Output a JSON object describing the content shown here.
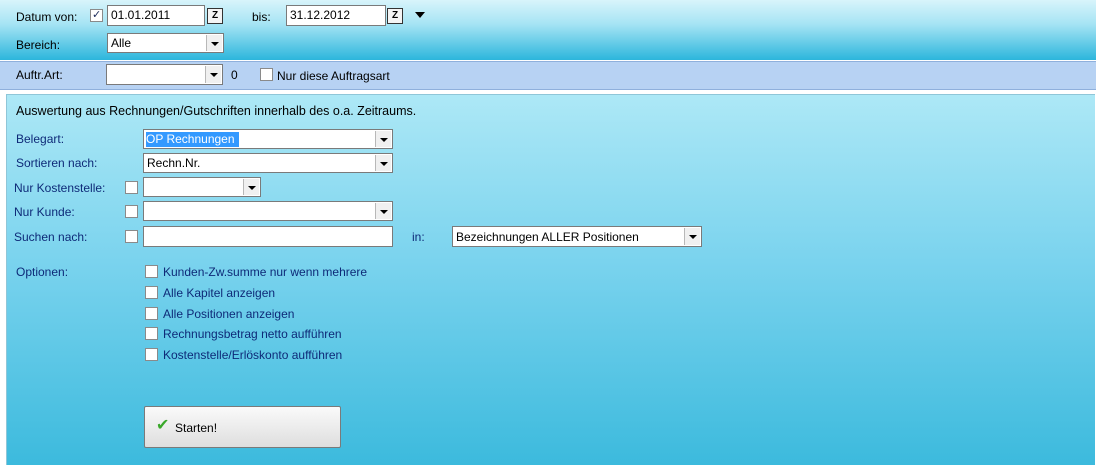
{
  "header": {
    "datum_von_label": "Datum von:",
    "datum_von_checked": true,
    "datum_von_value": "01.01.2011",
    "bis_label": "bis:",
    "bis_value": "31.12.2012",
    "calendar_glyph": "Z",
    "bereich_label": "Bereich:",
    "bereich_value": "Alle"
  },
  "auftr": {
    "label": "Auftr.Art:",
    "value": "",
    "count": "0",
    "nur_diese_label": "Nur diese Auftragsart",
    "nur_diese_checked": false
  },
  "main": {
    "description": "Auswertung aus Rechnungen/Gutschriften innerhalb des o.a. Zeitraums.",
    "belegart_label": "Belegart:",
    "belegart_value": "OP Rechnungen",
    "sortieren_label": "Sortieren nach:",
    "sortieren_value": "Rechn.Nr.",
    "kostenstelle_label": "Nur Kostenstelle:",
    "kostenstelle_value": "",
    "kunde_label": "Nur Kunde:",
    "kunde_value": "",
    "suchen_label": "Suchen nach:",
    "suchen_value": "",
    "in_label": "in:",
    "in_value": "Bezeichnungen ALLER Positionen",
    "optionen_label": "Optionen:",
    "options": [
      {
        "label": "Kunden-Zw.summe nur wenn mehrere",
        "checked": false
      },
      {
        "label": "Alle Kapitel anzeigen",
        "checked": false
      },
      {
        "label": "Alle Positionen anzeigen",
        "checked": false
      },
      {
        "label": "Rechnungsbetrag netto aufführen",
        "checked": false
      },
      {
        "label": "Kostenstelle/Erlöskonto aufführen",
        "checked": false
      }
    ],
    "start_label": "Starten!"
  },
  "colors": {
    "accent_highlight": "#3399ff",
    "label_navy": "#0e2a78",
    "band": "#b7d2f3"
  },
  "icons": {
    "start": "checkmark-icon",
    "calendar": "calendar-icon",
    "expand": "triangle-down-icon"
  }
}
